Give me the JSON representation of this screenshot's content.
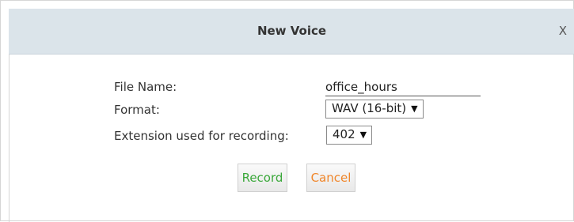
{
  "dialog": {
    "title": "New Voice",
    "close_label": "X"
  },
  "form": {
    "file_name": {
      "label": "File Name:",
      "value": "office_hours"
    },
    "format": {
      "label": "Format:",
      "selected": "WAV (16-bit)"
    },
    "extension": {
      "label": "Extension used for recording:",
      "selected": "402"
    }
  },
  "buttons": {
    "record_label": "Record",
    "cancel_label": "Cancel",
    "record_color": "#3aa83a",
    "cancel_color": "#f0862a"
  },
  "icons": {
    "dropdown": "▼"
  }
}
